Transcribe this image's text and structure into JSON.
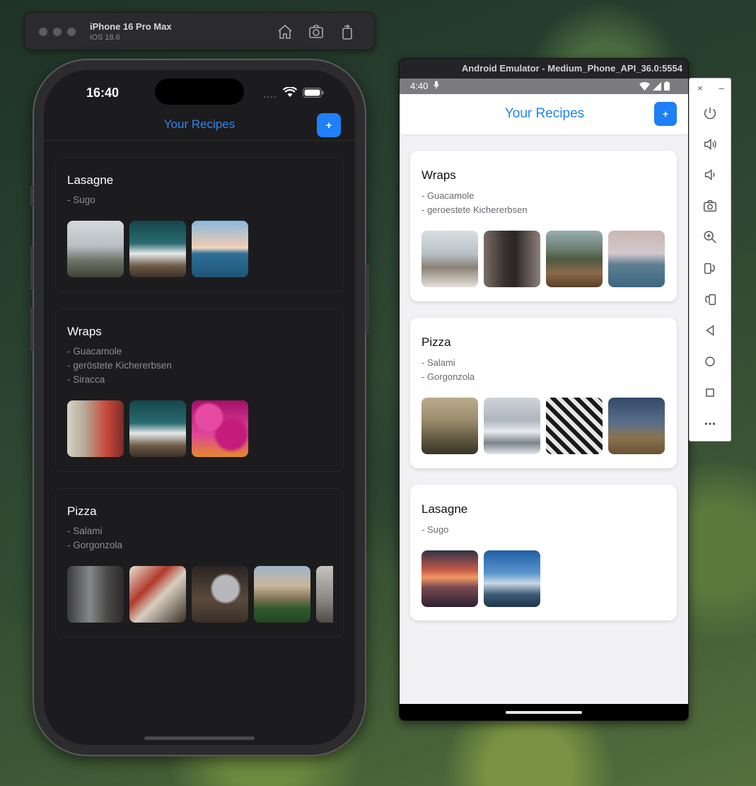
{
  "simulator": {
    "device_name": "iPhone 16 Pro Max",
    "os_version": "iOS 18.6",
    "tools": [
      "home-icon",
      "screenshot-icon",
      "rotate-icon"
    ]
  },
  "ios": {
    "time": "16:40",
    "signal_dots": "....",
    "header_title": "Your Recipes",
    "add_label": "+",
    "accent_color": "#2f87f0",
    "recipes": [
      {
        "name": "Lasagne",
        "ingredients": [
          "- Sugo"
        ],
        "images": [
          "misty-mountain-photo",
          "teal-mountain-range-photo",
          "ocean-horizon-photo"
        ]
      },
      {
        "name": "Wraps",
        "ingredients": [
          "- Guacamole",
          "- geröstete Kichererbsen",
          "- Siracca"
        ],
        "images": [
          "colorful-street-photo",
          "teal-mountain-range-photo",
          "magenta-flowers-photo"
        ]
      },
      {
        "name": "Pizza",
        "ingredients": [
          "- Salami",
          "- Gorgonzola"
        ],
        "images": [
          "foggy-forest-photo",
          "craft-tools-photo",
          "laptop-desk-photo",
          "college-building-photo",
          "city-street-photo"
        ]
      }
    ]
  },
  "android": {
    "window_title": "Android Emulator - Medium_Phone_API_36.0:5554",
    "time": "4:40",
    "header_title": "Your Recipes",
    "add_label": "+",
    "accent_color": "#1e84f2",
    "recipes": [
      {
        "name": "Wraps",
        "ingredients": [
          "- Guacamole",
          "- geroestete Kichererbsen"
        ],
        "images": [
          "pelican-pier-photo",
          "dark-tower-photo",
          "volcano-landscape-photo",
          "calm-lake-photo"
        ]
      },
      {
        "name": "Pizza",
        "ingredients": [
          "- Salami",
          "- Gorgonzola"
        ],
        "images": [
          "hazy-sunrise-photo",
          "snowy-peaks-photo",
          "steel-tower-photo",
          "desert-dune-photo"
        ]
      },
      {
        "name": "Lasagne",
        "ingredients": [
          "- Sugo"
        ],
        "images": [
          "sunset-sea-photo",
          "blue-sky-mountains-photo"
        ]
      }
    ]
  },
  "emulator_toolbar": {
    "close_label": "×",
    "minimize_label": "–",
    "buttons": [
      "power-icon",
      "volume-up-icon",
      "volume-down-icon",
      "camera-icon",
      "zoom-icon",
      "rotate-left-icon",
      "rotate-right-icon",
      "back-icon",
      "home-icon",
      "overview-icon",
      "more-icon"
    ]
  }
}
